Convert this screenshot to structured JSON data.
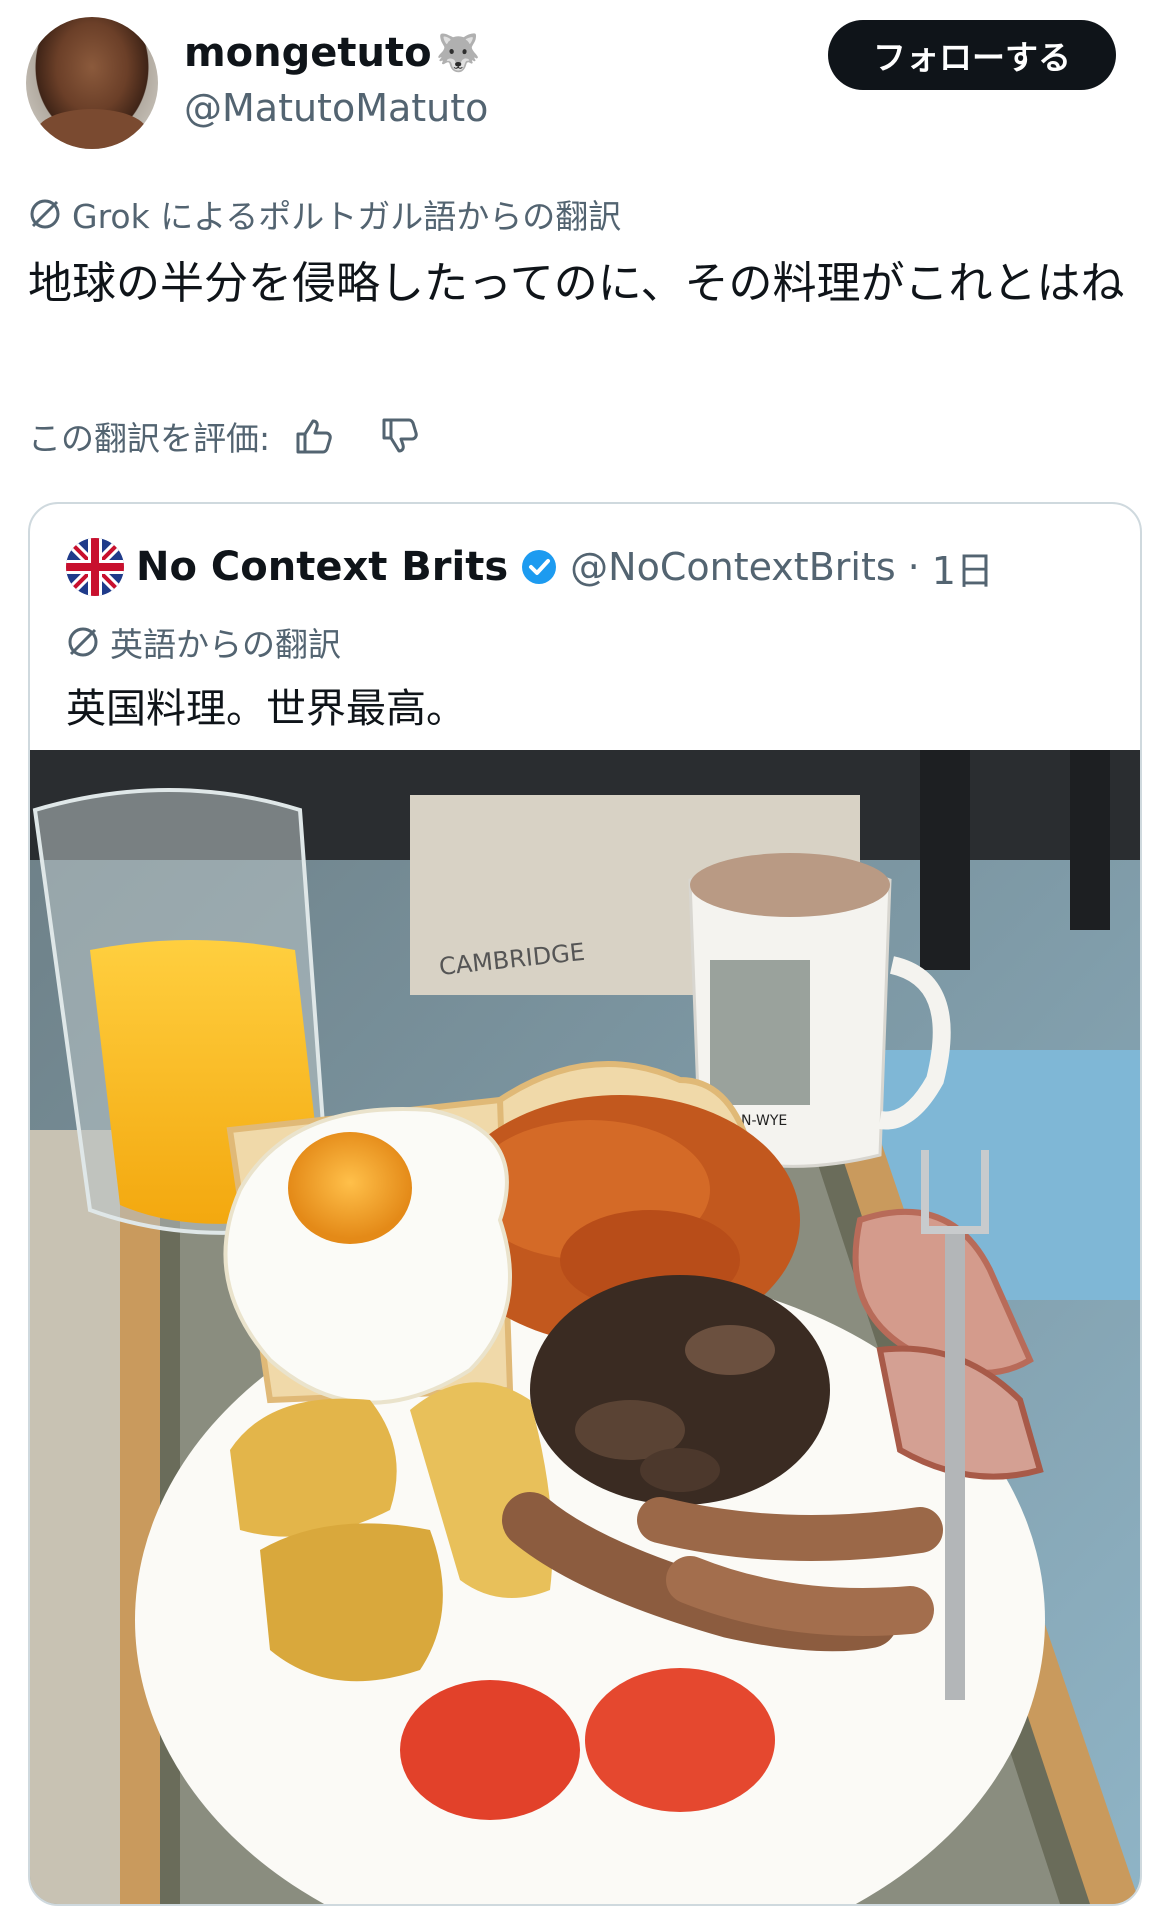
{
  "author": {
    "display_name": "mongetuto",
    "name_emoji": "🐺",
    "handle": "@MatutoMatuto"
  },
  "follow_button": "フォローする",
  "translation": {
    "source_note": "Grok によるポルトガル語からの翻訳",
    "text": "地球の半分を侵略したってのに、その料理がこれとはね",
    "rate_label": "この翻訳を評価:"
  },
  "quoted": {
    "name": "No Context Brits",
    "handle": "@NoContextBrits",
    "time": "1日",
    "separator": "·",
    "translation_note": "英語からの翻訳",
    "text": "英国料理。世界最高。",
    "photo_labels": {
      "box": "CAMBRIDGE",
      "mug": "ON-WYE"
    }
  },
  "colors": {
    "primary_text": "#0f1419",
    "secondary_text": "#536471",
    "verified": "#1d9bf0",
    "border": "#cfd9de"
  }
}
